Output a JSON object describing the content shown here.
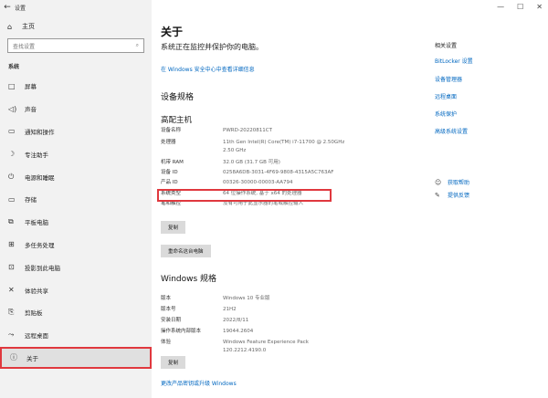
{
  "titlebar": {
    "back_icon": "back-arrow-icon",
    "title": "设置"
  },
  "window_controls": {
    "minimize": "—",
    "maximize": "☐",
    "close": "✕"
  },
  "sidebar": {
    "home": "主页",
    "search_placeholder": "查找设置",
    "section": "系统",
    "items": [
      {
        "icon": "□",
        "label": "屏幕"
      },
      {
        "icon": "◁)",
        "label": "声音"
      },
      {
        "icon": "▭",
        "label": "通知和操作"
      },
      {
        "icon": "☽",
        "label": "专注助手"
      },
      {
        "icon": "⏻",
        "label": "电源和睡眠"
      },
      {
        "icon": "▭",
        "label": "存储"
      },
      {
        "icon": "⧉",
        "label": "平板电脑"
      },
      {
        "icon": "⊞",
        "label": "多任务处理"
      },
      {
        "icon": "⊡",
        "label": "投影到此电脑"
      },
      {
        "icon": "✕",
        "label": "体验共享"
      },
      {
        "icon": "⎘",
        "label": "剪贴板"
      },
      {
        "icon": "⤳",
        "label": "远程桌面"
      },
      {
        "icon": "ⓘ",
        "label": "关于"
      }
    ]
  },
  "main": {
    "title": "关于",
    "monitor_text": "系统正在监控并保护你的电脑。",
    "monitor_link": "在 Windows 安全中心中查看详细信息",
    "device_spec_title": "设备规格",
    "device_name": "高配主机",
    "device_specs": [
      {
        "k": "设备名称",
        "v": "PWRD-20220811CT"
      },
      {
        "k": "处理器",
        "v": "11th Gen Intel(R) Core(TM) i7-11700 @ 2.50GHz 2.50 GHz"
      },
      {
        "k": "机带 RAM",
        "v": "32.0 GB (31.7 GB 可用)"
      },
      {
        "k": "设备 ID",
        "v": "0258A6DB-3031-4F69-9808-4315A5C763AF"
      },
      {
        "k": "产品 ID",
        "v": "00326-30000-00003-AA794"
      },
      {
        "k": "系统类型",
        "v": "64 位操作系统, 基于 x64 的处理器"
      },
      {
        "k": "笔和触控",
        "v": "没有可用于此显示器的笔或触控输入"
      }
    ],
    "copy_button": "复制",
    "rename_button": "重命名这台电脑",
    "windows_spec_title": "Windows 规格",
    "windows_specs": [
      {
        "k": "版本",
        "v": "Windows 10 专业版"
      },
      {
        "k": "版本号",
        "v": "21H2"
      },
      {
        "k": "安装日期",
        "v": "2022/8/11"
      },
      {
        "k": "操作系统内部版本",
        "v": "19044.2604"
      },
      {
        "k": "体验",
        "v": "Windows Feature Experience Pack 120.2212.4190.0"
      }
    ],
    "copy_button2": "复制",
    "bottom_link": "更改产品密钥或升级 Windows"
  },
  "related": {
    "title": "相关设置",
    "links": [
      "BitLocker 设置",
      "设备管理器",
      "远程桌面",
      "系统保护",
      "高级系统设置"
    ],
    "help": [
      {
        "icon": "chat-help-icon",
        "glyph": "☺",
        "label": "获取帮助"
      },
      {
        "icon": "feedback-icon",
        "glyph": "✎",
        "label": "提供反馈"
      }
    ]
  }
}
